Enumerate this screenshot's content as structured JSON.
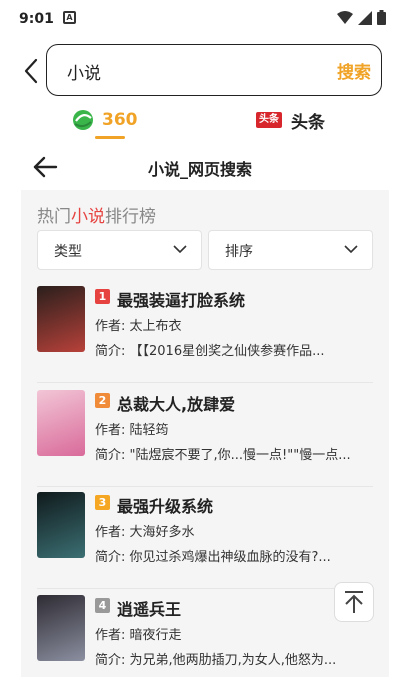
{
  "status_bar": {
    "time": "9:01",
    "notif_letter": "A"
  },
  "search": {
    "query": "小说",
    "button_label": "搜索"
  },
  "engines": [
    {
      "label": "360"
    },
    {
      "logo_text": "头条",
      "label": "头条"
    }
  ],
  "page": {
    "title": "小说_网页搜索"
  },
  "hot_list": {
    "title_prefix": "热门",
    "title_highlight": "小说",
    "title_suffix": "排行榜",
    "filters": [
      {
        "label": "类型"
      },
      {
        "label": "排序"
      }
    ],
    "books": [
      {
        "rank": "1",
        "rank_color": "#e64340",
        "title": "最强装逼打脸系统",
        "author": "作者:  太上布衣",
        "intro": "简介:  【【2016星创奖之仙侠参赛作品...",
        "cover_colors": [
          "#2a1f1c",
          "#b8413a"
        ]
      },
      {
        "rank": "2",
        "rank_color": "#f08b3a",
        "title": "总裁大人,放肆爱",
        "author": "作者:  陆轻筠",
        "intro": "简介:  \"陆煜宸不要了,你...慢一点!\"\"慢一点...",
        "cover_colors": [
          "#f2c6d6",
          "#d96a9a"
        ]
      },
      {
        "rank": "3",
        "rank_color": "#f5a623",
        "title": "最强升级系统",
        "author": "作者:  大海好多水",
        "intro": "简介:  你见过杀鸡爆出神级血脉的没有?...",
        "cover_colors": [
          "#101a1c",
          "#3b6f73"
        ]
      },
      {
        "rank": "4",
        "rank_color": "#999999",
        "title": "逍遥兵王",
        "author": "作者:  暗夜行走",
        "intro": "简介:  为兄弟,他两肋插刀,为女人,他怒为...",
        "cover_colors": [
          "#2e2b33",
          "#8b8fa0"
        ]
      }
    ]
  },
  "colors": {
    "accent": "#f0a326",
    "red": "#e64340"
  }
}
